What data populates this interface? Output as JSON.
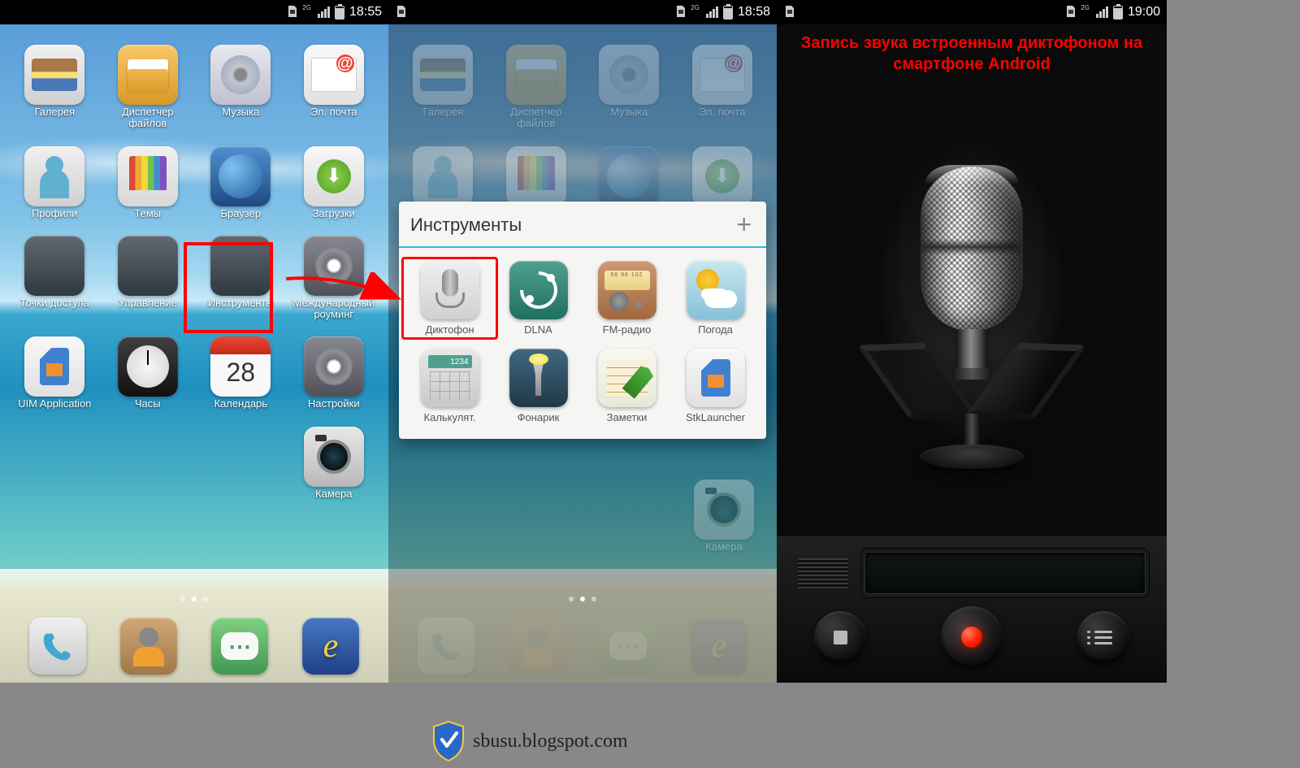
{
  "status": {
    "net_label": "2G",
    "times": {
      "p1": "18:55",
      "p2": "18:58",
      "p3": "19:00"
    }
  },
  "panel1": {
    "apps": [
      {
        "id": "gallery",
        "label": "Галерея"
      },
      {
        "id": "files",
        "label": "Диспетчер файлов"
      },
      {
        "id": "music",
        "label": "Музыка"
      },
      {
        "id": "email",
        "label": "Эл. почта"
      },
      {
        "id": "profiles",
        "label": "Профили"
      },
      {
        "id": "themes",
        "label": "Темы"
      },
      {
        "id": "browser",
        "label": "Браузер"
      },
      {
        "id": "downloads",
        "label": "Загрузки"
      },
      {
        "id": "access",
        "label": "Точки доступа"
      },
      {
        "id": "manage",
        "label": "Управление"
      },
      {
        "id": "tools",
        "label": "Инструменты"
      },
      {
        "id": "roaming",
        "label": "Международный роуминг"
      },
      {
        "id": "uim",
        "label": "UIM Application"
      },
      {
        "id": "clock",
        "label": "Часы"
      },
      {
        "id": "calendar",
        "label": "Календарь",
        "badge": "28"
      },
      {
        "id": "settings",
        "label": "Настройки"
      },
      {
        "id": "camera",
        "label": "Камера"
      }
    ],
    "dock": [
      {
        "id": "phone",
        "label": "Телефон"
      },
      {
        "id": "contacts",
        "label": "Контакты"
      },
      {
        "id": "messages",
        "label": "Сообщения"
      },
      {
        "id": "internet",
        "label": "Интернет"
      }
    ]
  },
  "panel2": {
    "folder_title": "Инструменты",
    "apps": [
      {
        "id": "recorder",
        "label": "Диктофон"
      },
      {
        "id": "dlna",
        "label": "DLNA"
      },
      {
        "id": "radio",
        "label": "FM-радио",
        "dial": "96 98 102"
      },
      {
        "id": "weather",
        "label": "Погода"
      },
      {
        "id": "calc",
        "label": "Калькулят."
      },
      {
        "id": "torch",
        "label": "Фонарик"
      },
      {
        "id": "notes",
        "label": "Заметки"
      },
      {
        "id": "stk",
        "label": "StkLauncher"
      }
    ],
    "bg_apps": [
      {
        "id": "gallery",
        "label": "Галерея"
      },
      {
        "id": "files",
        "label": "Диспетчер файлов"
      },
      {
        "id": "music",
        "label": "Музыка"
      },
      {
        "id": "email",
        "label": "Эл. почта"
      }
    ],
    "bg_camera_label": "Камера"
  },
  "panel3": {
    "title": "Запись звука встроенным диктофоном на смартфоне Android"
  },
  "watermark": "sbusu.blogspot.com"
}
